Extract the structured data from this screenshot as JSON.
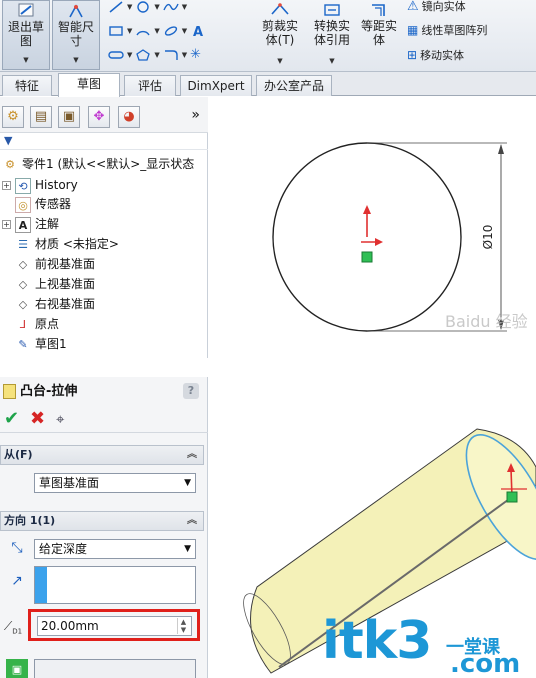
{
  "ribbon": {
    "exit_sketch_line1": "退出草",
    "exit_sketch_line2": "图",
    "smart_dim_line1": "智能尺",
    "smart_dim_line2": "寸",
    "trim_line1": "剪裁实",
    "trim_line2": "体(T)",
    "convert_line1": "转换实",
    "convert_line2": "体引用",
    "offset_line1": "等距实",
    "offset_line2": "体",
    "mirror": "镜向实体",
    "linear_pattern": "线性草图阵列",
    "move": "移动实体"
  },
  "tabs": [
    "特征",
    "草图",
    "评估",
    "DimXpert",
    "办公室产品"
  ],
  "tabs_active": "草图",
  "feature_tree": {
    "filter_icon": "filter-icon",
    "more": "»",
    "root": "零件1  (默认<<默认>_显示状态",
    "items": [
      {
        "label": "History",
        "icon": "history-icon"
      },
      {
        "label": "传感器",
        "icon": "sensor-icon"
      },
      {
        "label": "注解",
        "icon": "annotation-icon"
      },
      {
        "label": "材质 <未指定>",
        "icon": "material-icon"
      },
      {
        "label": "前视基准面",
        "icon": "plane-icon"
      },
      {
        "label": "上视基准面",
        "icon": "plane-icon"
      },
      {
        "label": "右视基准面",
        "icon": "plane-icon"
      },
      {
        "label": "原点",
        "icon": "origin-icon"
      },
      {
        "label": "草图1",
        "icon": "sketch-icon"
      }
    ]
  },
  "sketch": {
    "dimension_label": "Ø10",
    "watermark": "Baidu 经验"
  },
  "property_manager": {
    "title": "凸台-拉伸",
    "help": "?",
    "from_header": "从(F)",
    "from_value": "草图基准面",
    "direction_header": "方向 1(1)",
    "end_condition": "给定深度",
    "depth_value": "20.00mm",
    "depth_label": "D1"
  },
  "watermark": {
    "main": "itk3",
    "dot": ".com",
    "sub": "一堂课"
  },
  "colors": {
    "cylinder_fill": "#f4f1b8",
    "highlight_red": "#e0201b",
    "origin_red": "#e03030",
    "accent_blue": "#3ba2ec"
  }
}
